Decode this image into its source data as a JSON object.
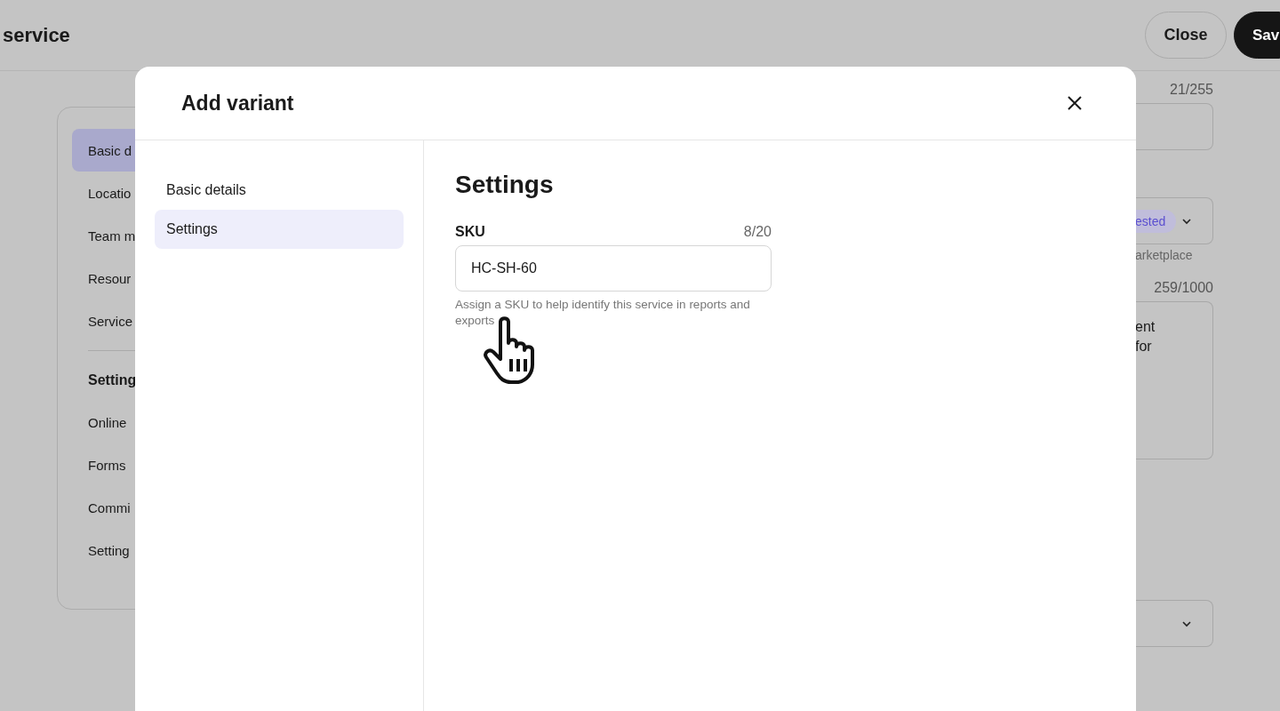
{
  "page": {
    "title": "service",
    "buttons": [
      {
        "label": "Close",
        "kind": "secondary"
      },
      {
        "label": "Sav",
        "kind": "primary"
      }
    ]
  },
  "sidebar": {
    "items": [
      {
        "label": "Basic d",
        "selected": true
      },
      {
        "label": "Locatio",
        "selected": false
      },
      {
        "label": "Team m",
        "selected": false
      },
      {
        "label": "Resour",
        "selected": false
      },
      {
        "label": "Service",
        "selected": false
      }
    ],
    "section_title": "Setting",
    "section_items": [
      {
        "label": "Online",
        "selected": false
      },
      {
        "label": "Forms",
        "selected": false
      },
      {
        "label": "Commi",
        "selected": false
      },
      {
        "label": "Setting",
        "selected": false
      }
    ]
  },
  "form": {
    "field_1_counter": "21/255",
    "field_2_badge": "ested",
    "field_2_hint": "arketplace",
    "field_3_counter": "259/1000",
    "field_3_lines": [
      "ent",
      "for"
    ]
  },
  "modal": {
    "title": "Add variant",
    "nav": [
      {
        "label": "Basic details",
        "selected": false
      },
      {
        "label": "Settings",
        "selected": true
      }
    ],
    "heading": "Settings",
    "field": {
      "label": "SKU",
      "counter": "8/20",
      "value": "HC-SH-60",
      "help": "Assign a SKU to help identify this service in reports and exports"
    }
  }
}
